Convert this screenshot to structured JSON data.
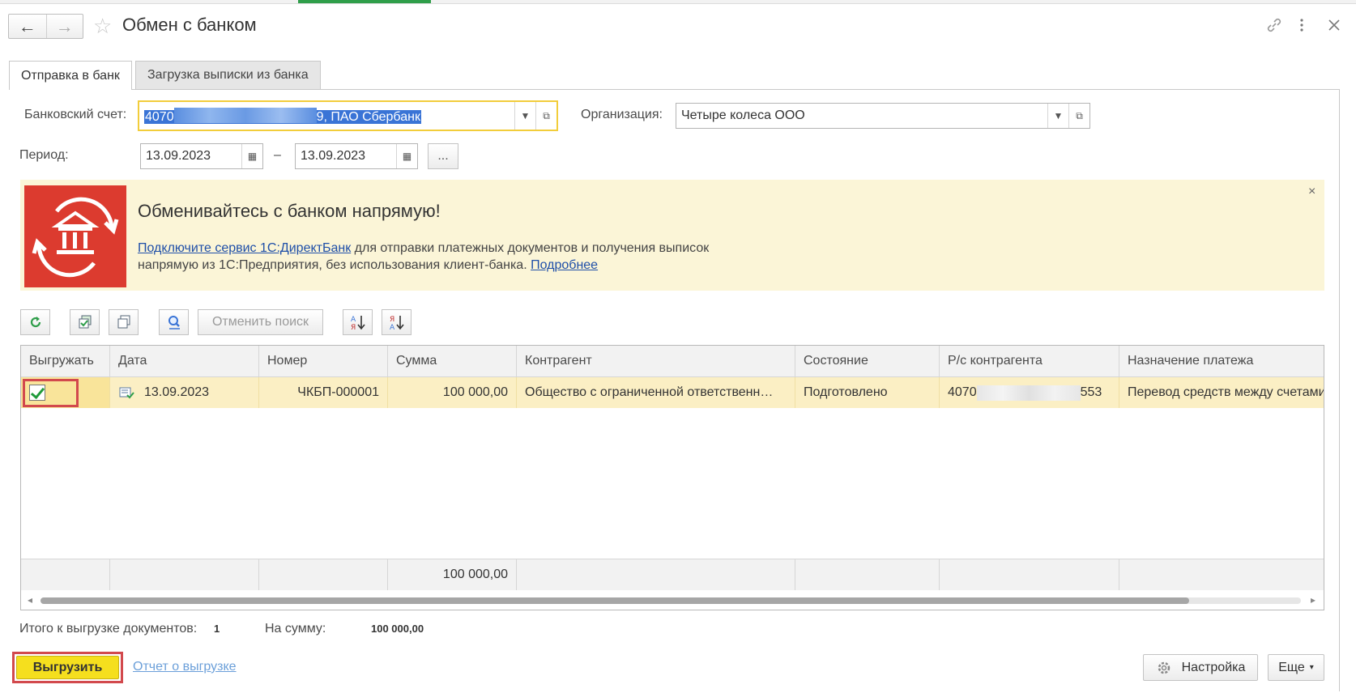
{
  "window": {
    "title": "Обмен с банком",
    "back_icon": "←",
    "forward_icon": "→"
  },
  "tabs": [
    {
      "label": "Отправка в банк",
      "active": true
    },
    {
      "label": "Загрузка выписки из банка",
      "active": false
    }
  ],
  "form": {
    "bank_account_label": "Банковский счет:",
    "bank_account_prefix": "4070",
    "bank_account_suffix": "9, ПАО Сбербанк",
    "organization_label": "Организация:",
    "organization_value": "Четыре колеса ООО",
    "period_label": "Период:",
    "period_from": "13.09.2023",
    "period_dash": "–",
    "period_to": "13.09.2023",
    "period_more": "..."
  },
  "banner": {
    "title": "Обменивайтесь с банком напрямую!",
    "link_connect": "Подключите сервис 1С:ДиректБанк",
    "text_1": " для отправки платежных документов и получения выписок",
    "text_2": "напрямую из 1С:Предприятия, без использования клиент-банка. ",
    "link_more": "Подробнее",
    "close": "×"
  },
  "toolbar": {
    "cancel_search": "Отменить поиск"
  },
  "table": {
    "columns": [
      "Выгружать",
      "Дата",
      "Номер",
      "Сумма",
      "Контрагент",
      "Состояние",
      "Р/с контрагента",
      "Назначение платежа"
    ],
    "rows": [
      {
        "date": "13.09.2023",
        "number": "ЧКБП-000001",
        "sum": "100 000,00",
        "counterparty": "Общество с ограниченной ответственн…",
        "state": "Подготовлено",
        "account_prefix": "4070",
        "account_suffix": "553",
        "purpose": "Перевод средств между счетами"
      }
    ],
    "footer_sum": "100 000,00"
  },
  "summary": {
    "total_label": "Итого к выгрузке документов:",
    "total_value": "1",
    "sum_label": "На сумму:",
    "sum_value": "100 000,00"
  },
  "buttons": {
    "export": "Выгрузить",
    "report": "Отчет о выгрузке",
    "settings": "Настройка",
    "more": "Еще"
  },
  "colors": {
    "accent_yellow": "#f5df1e",
    "highlight_red": "#d2494d",
    "banner_bg": "#fbf5d7",
    "logo_red": "#dc3b2f"
  }
}
